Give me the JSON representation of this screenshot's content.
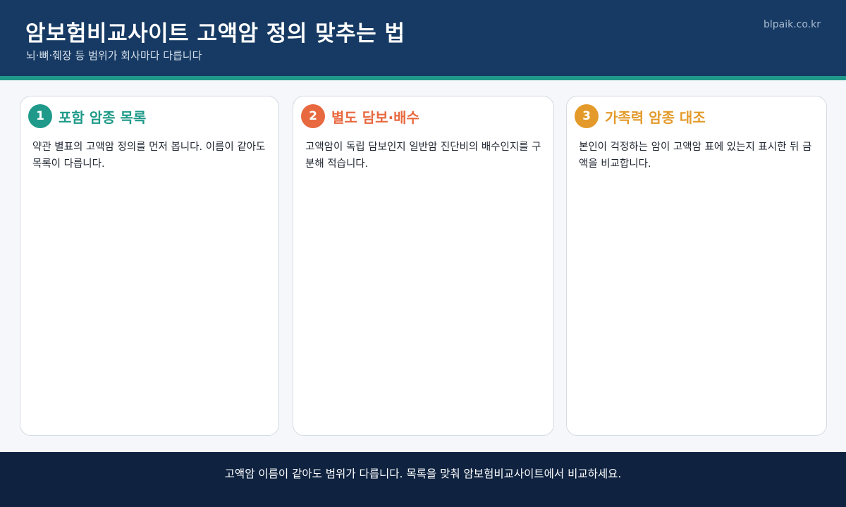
{
  "header": {
    "title": "암보험비교사이트 고액암 정의 맞추는 법",
    "subtitle": "뇌·뼈·췌장 등 범위가 회사마다 다릅니다",
    "domain": "blpaik.co.kr"
  },
  "cards": [
    {
      "number": "1",
      "title": "포함 암종 목록",
      "body": "약관 별표의 고액암 정의를 먼저 봅니다. 이름이 같아도 목록이 다릅니다.",
      "color": "#1f9a8a"
    },
    {
      "number": "2",
      "title": "별도 담보·배수",
      "body": "고액암이 독립 담보인지 일반암 진단비의 배수인지를 구분해 적습니다.",
      "color": "#e8693f"
    },
    {
      "number": "3",
      "title": "가족력 암종 대조",
      "body": "본인이 걱정하는 암이 고액암 표에 있는지 표시한 뒤 금액을 비교합니다.",
      "color": "#e39a2a"
    }
  ],
  "footer": {
    "text": "고액암 이름이 같아도 범위가 다릅니다. 목록을 맞춰 암보험비교사이트에서 비교하세요."
  }
}
